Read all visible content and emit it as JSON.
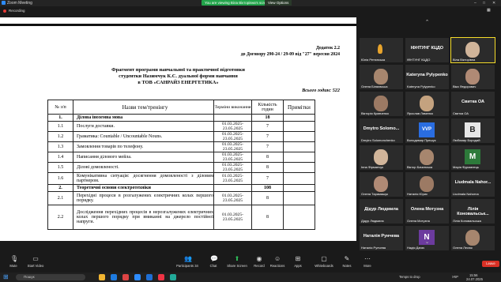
{
  "window": {
    "title": "Zoom Meeting",
    "share_notice": "You are viewing Віла Вікторівна's screen",
    "view_options": "View Options",
    "recording": "Recording"
  },
  "document": {
    "appendix_line1": "Додаток 2.2",
    "appendix_line2": "до Договору 290-24 / 29-09 від \"27\" вересня 2024",
    "title1": "Фрагмент програми навчальної та практичної підготовки",
    "title2": "студентки Назимчук К.С. дуальної форми навчання",
    "title3": "в ТОВ «САНРАЙЗ ЕНЕРГЕТИКА»",
    "total_hours": "Всього годин: 522",
    "headers": [
      "№ з/п",
      "Назви тем/тренінгу",
      "Терміни виконання",
      "Кількість годин",
      "Примітки"
    ],
    "rows": [
      {
        "num": "1.",
        "name": "Ділова іноземна мова",
        "dates": "",
        "hours": "18",
        "section": true
      },
      {
        "num": "1.1",
        "name": "Послуги доставки.",
        "dates": "01.03.2025-23.05.2025",
        "hours": "7"
      },
      {
        "num": "1.2",
        "name": "Граматика: Countable / Uncountable Nouns.",
        "dates": "01.03.2025-23.05.2025",
        "hours": "7"
      },
      {
        "num": "1.3",
        "name": "Замовлення товарів по телефону.",
        "dates": "01.03.2025-23.05.2025",
        "hours": "7"
      },
      {
        "num": "1.4",
        "name": "Написання ділового мейла.",
        "dates": "01.03.2025-23.05.2025",
        "hours": "8"
      },
      {
        "num": "1.5",
        "name": "Ділові домовленості.",
        "dates": "01.03.2025-23.05.2025",
        "hours": "8"
      },
      {
        "num": "1.6",
        "name": "Комунікативна ситуація: досягнення домовленості з діловим партнером.",
        "dates": "01.03.2025-23.05.2025",
        "hours": "7"
      },
      {
        "num": "2.",
        "name": "Теоретичні основи електротехніки",
        "dates": "",
        "hours": "108",
        "section": true
      },
      {
        "num": "2.1",
        "name": "Перехідні процеси в розгалужених електричних колах першого порядку.",
        "dates": "01.03.2025-23.05.2025",
        "hours": "8"
      },
      {
        "num": "2.2",
        "name": "Дослідження перехідних процесів в нерозгалужених електричних колах першого порядку при вмиканні на джерело постійної напруги.",
        "dates": "01.03.2025-23.05.2025",
        "hours": "8"
      }
    ]
  },
  "participants": [
    {
      "name": "Юлія Ретюнська"
    },
    {
      "name": "ІФНТУНГ КЦДО",
      "big": "ІФНТУНГ КЦДО"
    },
    {
      "name": "Віла Вікторівна"
    },
    {
      "name": "Олена Біляєвська"
    },
    {
      "name": "Kateryna Pylypenko",
      "big": "Kateryna Pylypenko"
    },
    {
      "name": "Віка Федорович"
    },
    {
      "name": "Вікторія Кравченко"
    },
    {
      "name": "Ярослав Ляменко"
    },
    {
      "name": "Свитка ОА",
      "big": "Свитка ОА"
    },
    {
      "name": "Dmytro Solomonchenko",
      "big": "Dmytro Solomo..."
    },
    {
      "name": "Володимир Прешук"
    },
    {
      "name": "Любомир Бородай"
    },
    {
      "name": "Інна Фірманчук"
    },
    {
      "name": "Віктор Бачинська"
    },
    {
      "name": "Марія Фурманець"
    },
    {
      "name": "Олена Тарамашук"
    },
    {
      "name": "Наталія Юрис"
    },
    {
      "name": "Liudmala Nahorna",
      "big": "Liudmala Nahor..."
    },
    {
      "name": "Дідур Людмила",
      "big": "Дідур Людмила"
    },
    {
      "name": "Олена Мотузна",
      "big": "Олена Мотузна"
    },
    {
      "name": "Лілія Коновальська",
      "big": "Лілія Коновальськ..."
    },
    {
      "name": "Наталія Рунчева",
      "big": "Наталія Рунчева"
    },
    {
      "name": "Надія Дагач"
    },
    {
      "name": "Олена Лесюк"
    }
  ],
  "toolbar": {
    "mute": "Mute",
    "video": "Start Video",
    "participants": "Participants",
    "participants_count": "34",
    "chat": "Chat",
    "share": "Share Screen",
    "record": "Record",
    "reactions": "Reactions",
    "apps": "Apps",
    "whiteboards": "Whiteboards",
    "notes": "Notes",
    "more": "More",
    "leave": "Leave"
  },
  "taskbar": {
    "search_placeholder": "Пошук",
    "weather": "Temps to drop",
    "lang": "УКР",
    "time": "15:56",
    "date": "24.07.2025"
  }
}
